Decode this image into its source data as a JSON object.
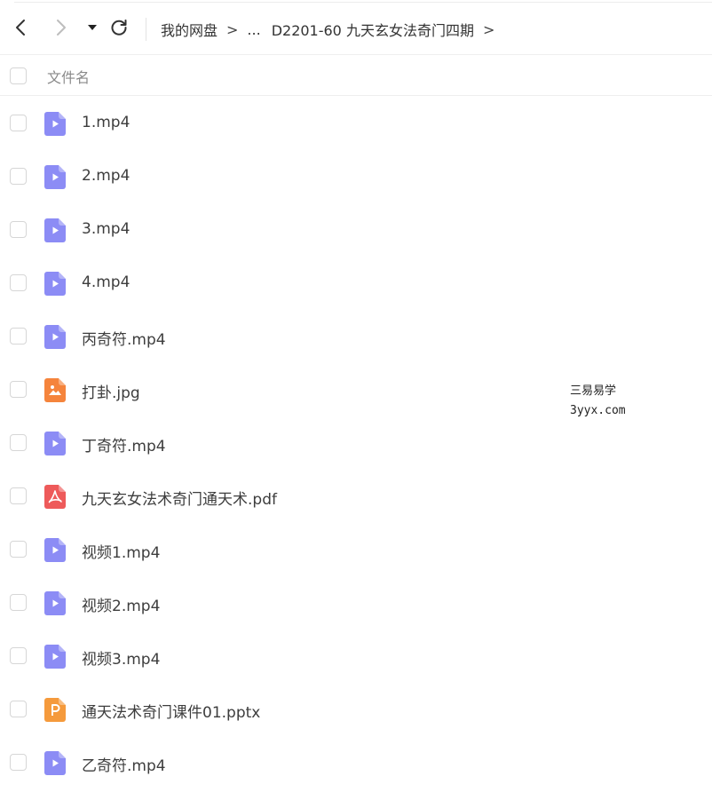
{
  "nav": {
    "back_icon": "chevron-left-icon",
    "forward_icon": "chevron-right-icon",
    "dropdown_icon": "caret-down-icon",
    "refresh_icon": "refresh-icon"
  },
  "breadcrumb": {
    "items": [
      "我的网盘",
      "...",
      "D2201-60 九天玄女法奇门四期"
    ],
    "separator": ">"
  },
  "header": {
    "column_label": "文件名"
  },
  "files": [
    {
      "name": "1.mp4",
      "type": "video"
    },
    {
      "name": "2.mp4",
      "type": "video"
    },
    {
      "name": "3.mp4",
      "type": "video"
    },
    {
      "name": "4.mp4",
      "type": "video"
    },
    {
      "name": "丙奇符.mp4",
      "type": "video"
    },
    {
      "name": "打卦.jpg",
      "type": "image"
    },
    {
      "name": "丁奇符.mp4",
      "type": "video"
    },
    {
      "name": "九天玄女法术奇门通天术.pdf",
      "type": "pdf"
    },
    {
      "name": "视频1.mp4",
      "type": "video"
    },
    {
      "name": "视频2.mp4",
      "type": "video"
    },
    {
      "name": "视频3.mp4",
      "type": "video"
    },
    {
      "name": "通天法术奇门课件01.pptx",
      "type": "pptx"
    },
    {
      "name": "乙奇符.mp4",
      "type": "video"
    }
  ],
  "watermark": {
    "line1": "三易易学",
    "line2": "3yyx.com"
  },
  "colors": {
    "video": "#8c8cf5",
    "image": "#f5843c",
    "pdf": "#ee5a5a",
    "pptx": "#f59a3c"
  }
}
